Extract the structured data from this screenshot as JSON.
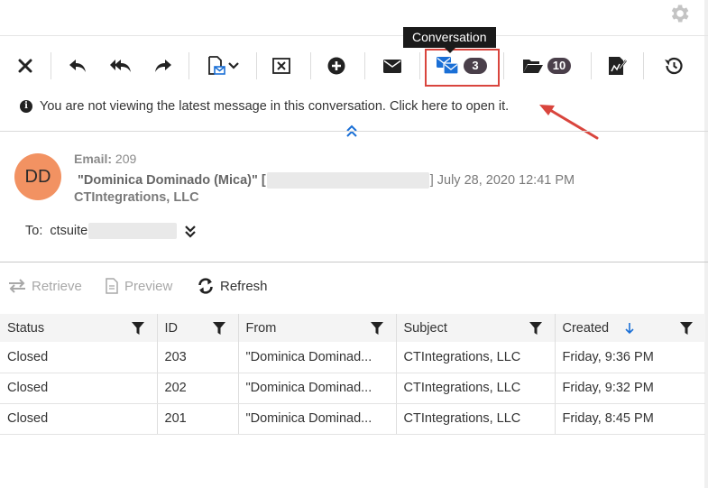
{
  "toolbar": {
    "tooltip": "Conversation",
    "conversation_count": "3",
    "folder_count": "10"
  },
  "notice": {
    "text": "You are not viewing the latest message in this conversation. Click here to open it."
  },
  "email": {
    "initials": "DD",
    "label": "Email:",
    "number": "209",
    "sender_name": "\"Dominica Dominado (Mica)\" [",
    "sender_close": "]",
    "date": "July 28, 2020 12:41 PM",
    "company": "CTIntegrations, LLC",
    "to_label": "To:",
    "to_value": "ctsuite"
  },
  "actions": {
    "retrieve": "Retrieve",
    "preview": "Preview",
    "refresh": "Refresh"
  },
  "grid": {
    "columns": [
      "Status",
      "ID",
      "From",
      "Subject",
      "Created"
    ],
    "rows": [
      [
        "Closed",
        "203",
        "\"Dominica Dominad...",
        "CTIntegrations, LLC",
        "Friday, 9:36 PM"
      ],
      [
        "Closed",
        "202",
        "\"Dominica Dominad...",
        "CTIntegrations, LLC",
        "Friday, 9:32 PM"
      ],
      [
        "Closed",
        "201",
        "\"Dominica Dominad...",
        "CTIntegrations, LLC",
        "Friday, 8:45 PM"
      ]
    ]
  },
  "colors": {
    "accent_blue": "#1a6fd6",
    "highlight_red": "#d9453d",
    "avatar_orange": "#f29262",
    "badge_dark": "#4a3f4a"
  },
  "icons": [
    "gear-icon",
    "close-icon",
    "reply-icon",
    "reply-all-icon",
    "forward-icon",
    "new-document-icon",
    "chevron-down-icon",
    "delete-box-icon",
    "add-circle-icon",
    "envelope-icon",
    "conversation-icon",
    "folder-icon",
    "sign-document-icon",
    "history-icon",
    "info-icon",
    "collapse-up-icon",
    "expand-down-icon",
    "arrows-icon",
    "document-icon",
    "refresh-icon",
    "filter-icon",
    "sort-down-icon"
  ]
}
